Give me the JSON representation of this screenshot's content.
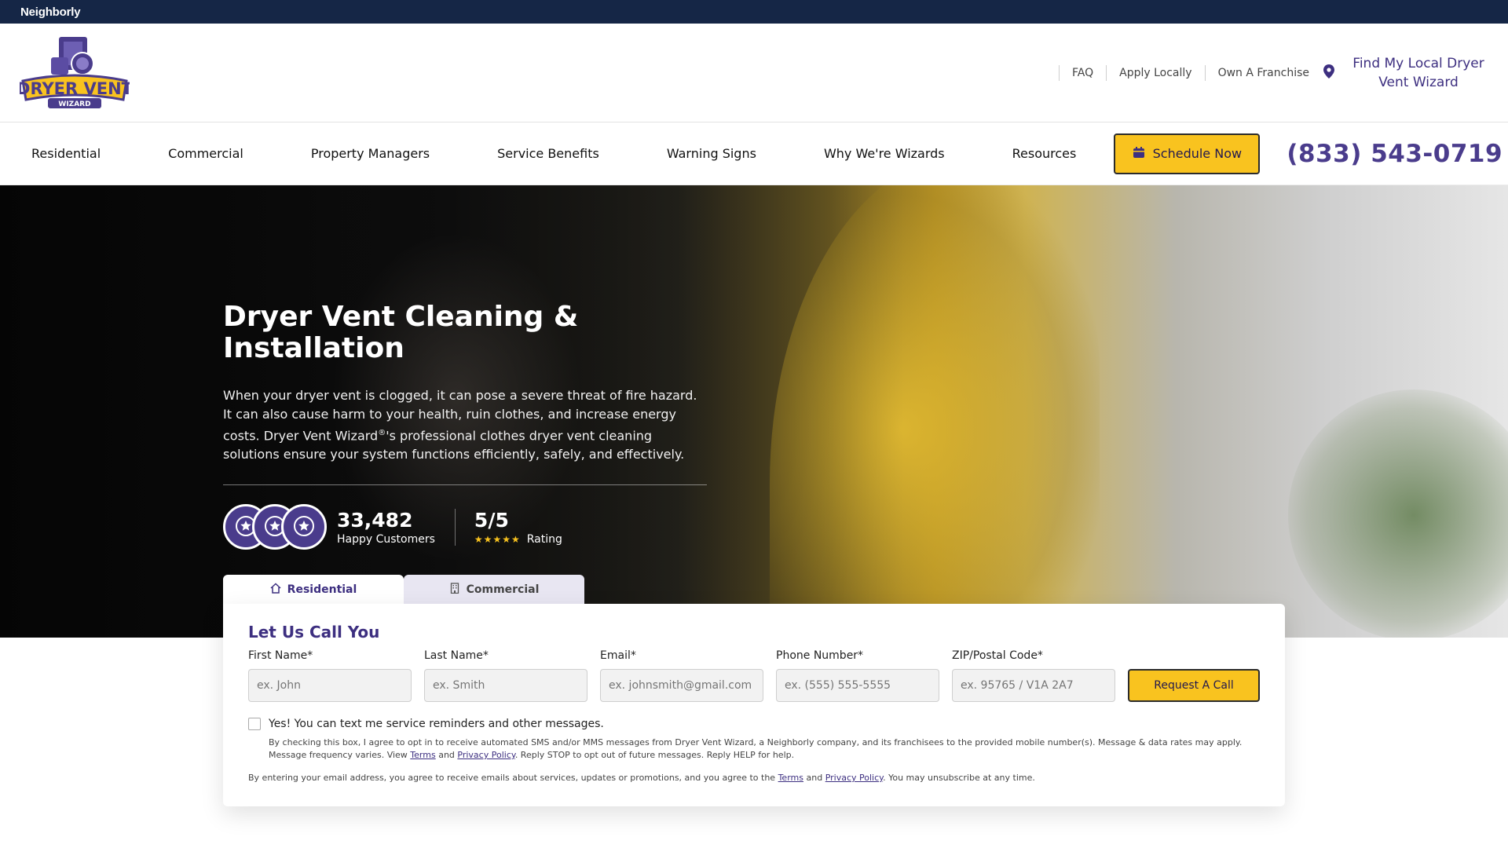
{
  "topbar": {
    "brand": "Neighborly"
  },
  "header": {
    "logo_text_main": "DRYER VENT",
    "logo_text_sub": "WIZARD",
    "links": [
      "FAQ",
      "Apply Locally",
      "Own A Franchise"
    ],
    "find_local": "Find My Local Dryer Vent Wizard"
  },
  "nav": {
    "items": [
      "Residential",
      "Commercial",
      "Property Managers",
      "Service Benefits",
      "Warning Signs",
      "Why We're Wizards",
      "Resources"
    ],
    "schedule_label": "Schedule Now",
    "phone": "(833) 543-0719"
  },
  "hero": {
    "title": "Dryer Vent Cleaning & Installation",
    "description_part1": "When your dryer vent is clogged, it can pose a severe threat of fire hazard. It can also cause harm to your health, ruin clothes, and increase energy costs. Dryer Vent Wizard",
    "registered": "®",
    "description_part2": "'s professional clothes dryer vent cleaning solutions ensure your system functions efficiently, safely, and effectively.",
    "customers_count": "33,482",
    "customers_label": "Happy Customers",
    "rating_value": "5/5",
    "rating_stars": "★★★★★",
    "rating_label": "Rating"
  },
  "tabs": [
    "Residential",
    "Commercial"
  ],
  "form": {
    "title": "Let Us Call You",
    "fields": [
      {
        "label": "First Name*",
        "placeholder": "ex. John"
      },
      {
        "label": "Last Name*",
        "placeholder": "ex. Smith"
      },
      {
        "label": "Email*",
        "placeholder": "ex. johnsmith@gmail.com"
      },
      {
        "label": "Phone Number*",
        "placeholder": "ex. (555) 555-5555"
      },
      {
        "label": "ZIP/Postal Code*",
        "placeholder": "ex. 95765 / V1A 2A7"
      }
    ],
    "submit_label": "Request A Call",
    "consent_label": "Yes! You can text me service reminders and other messages.",
    "fine_a": "By checking this box, I agree to opt in to receive automated SMS and/or MMS messages from Dryer Vent Wizard, a Neighborly company, and its franchisees to the provided mobile number(s). Message & data rates may apply. Message frequency varies. View ",
    "terms": "Terms",
    "and": " and ",
    "privacy": "Privacy Policy",
    "fine_b": ". Reply STOP to opt out of future messages. Reply HELP for help.",
    "email_a": "By entering your email address, you agree to receive emails about services, updates or promotions, and you agree to the ",
    "email_b": ". You may unsubscribe at any time."
  },
  "colors": {
    "brand_purple": "#4a3c8c",
    "brand_yellow": "#f9c31f",
    "topbar_navy": "#152646"
  }
}
